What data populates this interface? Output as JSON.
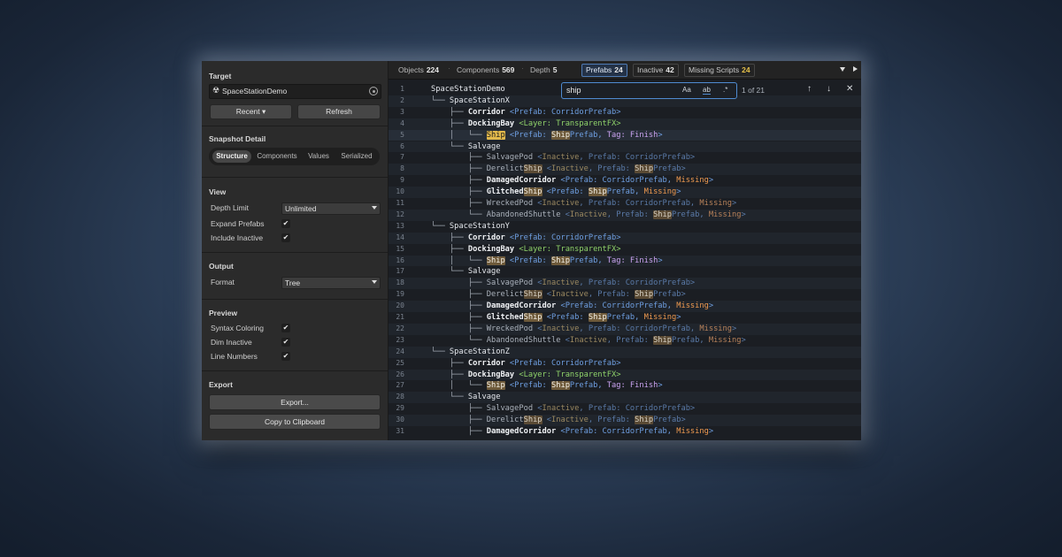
{
  "sidebar": {
    "target": {
      "title": "Target",
      "glyph": "☢",
      "object_name": "SpaceStationDemo",
      "recent_label": "Recent ▾",
      "refresh_label": "Refresh"
    },
    "snapshot": {
      "title": "Snapshot Detail",
      "segments": [
        "Structure",
        "Components",
        "Values",
        "Serialized"
      ],
      "selected": "Structure"
    },
    "view": {
      "title": "View",
      "depth_limit": {
        "label": "Depth Limit",
        "value": "Unlimited"
      },
      "expand_prefabs": {
        "label": "Expand Prefabs",
        "checked": true
      },
      "include_inactive": {
        "label": "Include Inactive",
        "checked": true
      }
    },
    "output": {
      "title": "Output",
      "format": {
        "label": "Format",
        "value": "Tree"
      }
    },
    "preview": {
      "title": "Preview",
      "syntax_coloring": {
        "label": "Syntax Coloring",
        "checked": true
      },
      "dim_inactive": {
        "label": "Dim Inactive",
        "checked": true
      },
      "line_numbers": {
        "label": "Line Numbers",
        "checked": true
      }
    },
    "export": {
      "title": "Export",
      "export_label": "Export...",
      "copy_label": "Copy to Clipboard"
    }
  },
  "toolbar": {
    "objects": {
      "label": "Objects",
      "value": "224"
    },
    "components": {
      "label": "Components",
      "value": "569"
    },
    "depth": {
      "label": "Depth",
      "value": "5"
    },
    "filters": [
      {
        "label": "Prefabs",
        "value": "24",
        "selected": true
      },
      {
        "label": "Inactive",
        "value": "42",
        "selected": false
      },
      {
        "label": "Missing Scripts",
        "value": "24",
        "selected": false
      }
    ]
  },
  "search": {
    "query": "ship",
    "match_case": "Aa",
    "whole_word": "ab",
    "regex": ".*",
    "count": "1 of 21"
  },
  "code": {
    "lines": [
      [
        {
          "t": "SpaceStationDemo",
          "c": "nm"
        }
      ],
      [
        {
          "t": "└── ",
          "c": "tree"
        },
        {
          "t": "SpaceStationX",
          "c": "nm"
        }
      ],
      [
        {
          "t": "    ├── ",
          "c": "tree"
        },
        {
          "t": "Corridor",
          "c": "nm bold"
        },
        {
          "t": " <Prefab: CorridorPrefab>",
          "c": "meta"
        }
      ],
      [
        {
          "t": "    ├── ",
          "c": "tree"
        },
        {
          "t": "DockingBay",
          "c": "nm bold"
        },
        {
          "t": " <Layer: TransparentFX>",
          "c": "layer"
        }
      ],
      [
        {
          "t": "    │   └── ",
          "c": "tree"
        },
        {
          "t": "Ship",
          "c": "m cur"
        },
        {
          "t": " <Prefab: ",
          "c": "meta"
        },
        {
          "t": "Ship",
          "c": "m"
        },
        {
          "t": "Prefab",
          "c": "meta"
        },
        {
          "t": ", ",
          "c": "meta"
        },
        {
          "t": "Tag: Finish",
          "c": "tag"
        },
        {
          "t": ">",
          "c": "meta"
        }
      ],
      [
        {
          "t": "    └── ",
          "c": "tree"
        },
        {
          "t": "Salvage",
          "c": "nm"
        }
      ],
      [
        {
          "t": "        ├── ",
          "c": "tree"
        },
        {
          "t": "SalvagePod",
          "c": "nm dim"
        },
        {
          "t": " <",
          "c": "meta dim"
        },
        {
          "t": "Inactive",
          "c": "inactive dim"
        },
        {
          "t": ", Prefab: CorridorPrefab>",
          "c": "meta dim"
        }
      ],
      [
        {
          "t": "        ├── ",
          "c": "tree"
        },
        {
          "t": "Derelict",
          "c": "nm dim"
        },
        {
          "t": "Ship",
          "c": "m dim"
        },
        {
          "t": " <",
          "c": "meta dim"
        },
        {
          "t": "Inactive",
          "c": "inactive dim"
        },
        {
          "t": ", Prefab: ",
          "c": "meta dim"
        },
        {
          "t": "Ship",
          "c": "m dim"
        },
        {
          "t": "Prefab>",
          "c": "meta dim"
        }
      ],
      [
        {
          "t": "        ├── ",
          "c": "tree"
        },
        {
          "t": "DamagedCorridor",
          "c": "nm bold"
        },
        {
          "t": " <Prefab: CorridorPrefab, ",
          "c": "meta"
        },
        {
          "t": "Missing",
          "c": "missing"
        },
        {
          "t": ">",
          "c": "meta"
        }
      ],
      [
        {
          "t": "        ├── ",
          "c": "tree"
        },
        {
          "t": "Glitched",
          "c": "nm bold"
        },
        {
          "t": "Ship",
          "c": "m"
        },
        {
          "t": " <Prefab: ",
          "c": "meta"
        },
        {
          "t": "Ship",
          "c": "m"
        },
        {
          "t": "Prefab, ",
          "c": "meta"
        },
        {
          "t": "Missing",
          "c": "missing"
        },
        {
          "t": ">",
          "c": "meta"
        }
      ],
      [
        {
          "t": "        ├── ",
          "c": "tree"
        },
        {
          "t": "WreckedPod",
          "c": "nm dim"
        },
        {
          "t": " <",
          "c": "meta dim"
        },
        {
          "t": "Inactive",
          "c": "inactive dim"
        },
        {
          "t": ", Prefab: CorridorPrefab, ",
          "c": "meta dim"
        },
        {
          "t": "Missing",
          "c": "missing dim"
        },
        {
          "t": ">",
          "c": "meta dim"
        }
      ],
      [
        {
          "t": "        └── ",
          "c": "tree"
        },
        {
          "t": "AbandonedShuttle",
          "c": "nm dim"
        },
        {
          "t": " <",
          "c": "meta dim"
        },
        {
          "t": "Inactive",
          "c": "inactive dim"
        },
        {
          "t": ", Prefab: ",
          "c": "meta dim"
        },
        {
          "t": "Ship",
          "c": "m dim"
        },
        {
          "t": "Prefab, ",
          "c": "meta dim"
        },
        {
          "t": "Missing",
          "c": "missing dim"
        },
        {
          "t": ">",
          "c": "meta dim"
        }
      ],
      [
        {
          "t": "└── ",
          "c": "tree"
        },
        {
          "t": "SpaceStationY",
          "c": "nm"
        }
      ],
      [
        {
          "t": "    ├── ",
          "c": "tree"
        },
        {
          "t": "Corridor",
          "c": "nm bold"
        },
        {
          "t": " <Prefab: CorridorPrefab>",
          "c": "meta"
        }
      ],
      [
        {
          "t": "    ├── ",
          "c": "tree"
        },
        {
          "t": "DockingBay",
          "c": "nm bold"
        },
        {
          "t": " <Layer: TransparentFX>",
          "c": "layer"
        }
      ],
      [
        {
          "t": "    │   └── ",
          "c": "tree"
        },
        {
          "t": "Ship",
          "c": "m"
        },
        {
          "t": " <Prefab: ",
          "c": "meta"
        },
        {
          "t": "Ship",
          "c": "m"
        },
        {
          "t": "Prefab",
          "c": "meta"
        },
        {
          "t": ", ",
          "c": "meta"
        },
        {
          "t": "Tag: Finish",
          "c": "tag"
        },
        {
          "t": ">",
          "c": "meta"
        }
      ],
      [
        {
          "t": "    └── ",
          "c": "tree"
        },
        {
          "t": "Salvage",
          "c": "nm"
        }
      ],
      [
        {
          "t": "        ├── ",
          "c": "tree"
        },
        {
          "t": "SalvagePod",
          "c": "nm dim"
        },
        {
          "t": " <",
          "c": "meta dim"
        },
        {
          "t": "Inactive",
          "c": "inactive dim"
        },
        {
          "t": ", Prefab: CorridorPrefab>",
          "c": "meta dim"
        }
      ],
      [
        {
          "t": "        ├── ",
          "c": "tree"
        },
        {
          "t": "Derelict",
          "c": "nm dim"
        },
        {
          "t": "Ship",
          "c": "m dim"
        },
        {
          "t": " <",
          "c": "meta dim"
        },
        {
          "t": "Inactive",
          "c": "inactive dim"
        },
        {
          "t": ", Prefab: ",
          "c": "meta dim"
        },
        {
          "t": "Ship",
          "c": "m dim"
        },
        {
          "t": "Prefab>",
          "c": "meta dim"
        }
      ],
      [
        {
          "t": "        ├── ",
          "c": "tree"
        },
        {
          "t": "DamagedCorridor",
          "c": "nm bold"
        },
        {
          "t": " <Prefab: CorridorPrefab, ",
          "c": "meta"
        },
        {
          "t": "Missing",
          "c": "missing"
        },
        {
          "t": ">",
          "c": "meta"
        }
      ],
      [
        {
          "t": "        ├── ",
          "c": "tree"
        },
        {
          "t": "Glitched",
          "c": "nm bold"
        },
        {
          "t": "Ship",
          "c": "m"
        },
        {
          "t": " <Prefab: ",
          "c": "meta"
        },
        {
          "t": "Ship",
          "c": "m"
        },
        {
          "t": "Prefab, ",
          "c": "meta"
        },
        {
          "t": "Missing",
          "c": "missing"
        },
        {
          "t": ">",
          "c": "meta"
        }
      ],
      [
        {
          "t": "        ├── ",
          "c": "tree"
        },
        {
          "t": "WreckedPod",
          "c": "nm dim"
        },
        {
          "t": " <",
          "c": "meta dim"
        },
        {
          "t": "Inactive",
          "c": "inactive dim"
        },
        {
          "t": ", Prefab: CorridorPrefab, ",
          "c": "meta dim"
        },
        {
          "t": "Missing",
          "c": "missing dim"
        },
        {
          "t": ">",
          "c": "meta dim"
        }
      ],
      [
        {
          "t": "        └── ",
          "c": "tree"
        },
        {
          "t": "AbandonedShuttle",
          "c": "nm dim"
        },
        {
          "t": " <",
          "c": "meta dim"
        },
        {
          "t": "Inactive",
          "c": "inactive dim"
        },
        {
          "t": ", Prefab: ",
          "c": "meta dim"
        },
        {
          "t": "Ship",
          "c": "m dim"
        },
        {
          "t": "Prefab, ",
          "c": "meta dim"
        },
        {
          "t": "Missing",
          "c": "missing dim"
        },
        {
          "t": ">",
          "c": "meta dim"
        }
      ],
      [
        {
          "t": "└── ",
          "c": "tree"
        },
        {
          "t": "SpaceStationZ",
          "c": "nm"
        }
      ],
      [
        {
          "t": "    ├── ",
          "c": "tree"
        },
        {
          "t": "Corridor",
          "c": "nm bold"
        },
        {
          "t": " <Prefab: CorridorPrefab>",
          "c": "meta"
        }
      ],
      [
        {
          "t": "    ├── ",
          "c": "tree"
        },
        {
          "t": "DockingBay",
          "c": "nm bold"
        },
        {
          "t": " <Layer: TransparentFX>",
          "c": "layer"
        }
      ],
      [
        {
          "t": "    │   └── ",
          "c": "tree"
        },
        {
          "t": "Ship",
          "c": "m"
        },
        {
          "t": " <Prefab: ",
          "c": "meta"
        },
        {
          "t": "Ship",
          "c": "m"
        },
        {
          "t": "Prefab",
          "c": "meta"
        },
        {
          "t": ", ",
          "c": "meta"
        },
        {
          "t": "Tag: Finish",
          "c": "tag"
        },
        {
          "t": ">",
          "c": "meta"
        }
      ],
      [
        {
          "t": "    └── ",
          "c": "tree"
        },
        {
          "t": "Salvage",
          "c": "nm"
        }
      ],
      [
        {
          "t": "        ├── ",
          "c": "tree"
        },
        {
          "t": "SalvagePod",
          "c": "nm dim"
        },
        {
          "t": " <",
          "c": "meta dim"
        },
        {
          "t": "Inactive",
          "c": "inactive dim"
        },
        {
          "t": ", Prefab: CorridorPrefab>",
          "c": "meta dim"
        }
      ],
      [
        {
          "t": "        ├── ",
          "c": "tree"
        },
        {
          "t": "Derelict",
          "c": "nm dim"
        },
        {
          "t": "Ship",
          "c": "m dim"
        },
        {
          "t": " <",
          "c": "meta dim"
        },
        {
          "t": "Inactive",
          "c": "inactive dim"
        },
        {
          "t": ", Prefab: ",
          "c": "meta dim"
        },
        {
          "t": "Ship",
          "c": "m dim"
        },
        {
          "t": "Prefab>",
          "c": "meta dim"
        }
      ],
      [
        {
          "t": "        ├── ",
          "c": "tree"
        },
        {
          "t": "DamagedCorridor",
          "c": "nm bold"
        },
        {
          "t": " <Prefab: CorridorPrefab, ",
          "c": "meta"
        },
        {
          "t": "Missing",
          "c": "missing"
        },
        {
          "t": ">",
          "c": "meta"
        }
      ]
    ]
  }
}
